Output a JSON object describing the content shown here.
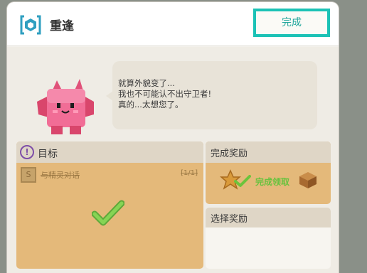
{
  "header": {
    "icon": "hexagon-badge-icon",
    "title": "重逢",
    "done_label": "完成"
  },
  "dialog": {
    "lines": [
      "就算外貌变了...",
      "我也不可能认不出守卫者!",
      "真的...太想您了。"
    ]
  },
  "goal": {
    "icon": "info-icon",
    "title": "目标",
    "task_text": "与精灵对话",
    "task_count": "[1/1]",
    "status_icon": "green-check-icon"
  },
  "reward": {
    "title": "完成奖励",
    "claimed_label": "完成领取",
    "items": [
      "gold-star-icon",
      "wood-crate-icon"
    ]
  },
  "select_reward": {
    "title": "选择奖励"
  },
  "colors": {
    "accent": "#1cc2b6",
    "panel": "#e4b97a",
    "check": "#69c23f"
  }
}
